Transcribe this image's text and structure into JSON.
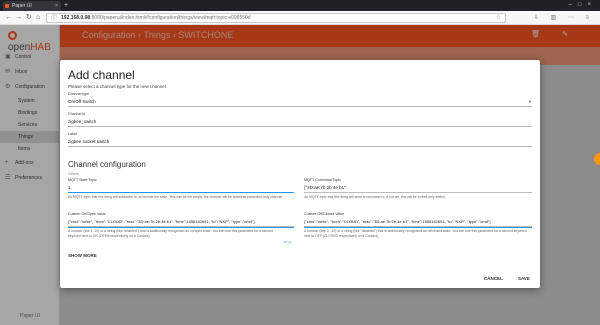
{
  "browser": {
    "tab_title": "Paper UI",
    "tab_close": "×",
    "new_tab": "+",
    "window_controls": "–□×",
    "back": "←",
    "forward": "→",
    "reload": "↻",
    "home": "⌂",
    "url_host": "192.168.0.98",
    "url_rest": ":8080/paperui/index.html#/configuration/things/view/mqtt:topic:e098550d",
    "toolbar_icons": "⇩ ▥ ⋯ ≡"
  },
  "app": {
    "logo_prefix": "open",
    "logo_brand": "HAB",
    "breadcrumb": "Configuration  ›  Things  ›  SWITCHONE",
    "footer": "Paper UI",
    "sidebar": [
      {
        "label": "Control",
        "icon": "▣"
      },
      {
        "label": "Inbox",
        "icon": "✉"
      },
      {
        "label": "Configuration",
        "icon": "⚙"
      },
      {
        "label": "System"
      },
      {
        "label": "Bindings"
      },
      {
        "label": "Services"
      },
      {
        "label": "Things"
      },
      {
        "label": "Items"
      },
      {
        "label": "Add-ons",
        "icon": "+"
      },
      {
        "label": "Preferences",
        "icon": "☰"
      }
    ],
    "header_icons": "🗑 ✎"
  },
  "dialog": {
    "title": "Add channel",
    "subtitle": "Please select a channel type for the new channel.",
    "channel_type_label": "Channel type",
    "channel_type_value": "On/Off Switch",
    "channel_id_label": "Channel id",
    "channel_id_value": "zigbee_switch",
    "label_label": "Label",
    "label_value": "zigbee socket switch",
    "section_title": "Channel configuration",
    "group_label": "Others",
    "state_topic_label": "MQTT State Topic",
    "state_topic_value": "1",
    "state_topic_help": "An MQTT topic that this thing will subscribe to, to receive the state. This can be left empty, the channel will be stateless command-only channel.",
    "command_topic_label": "MQTT Command Topic",
    "command_topic_value": "{\"3D:ae:7b:2b:4e:b1\"",
    "command_topic_help": "An MQTT topic that this thing will send a command to. If not set, this will be a read-only switch.",
    "on_value_label": "Custom On/Open Value",
    "on_value_value": "{\"cmd\":\"write\", \"from\":\"CLOUD\", \"mac\":\"3D:ae:7b:2b:4e:b1\", \"time\":1556182691, \"to\":\"NXP\", \"type\":\"cmd\"}",
    "on_value_help": "A number (like 1, 10) or a string (like \"enabled\") that is additionally recognised as on/open state. You can use this parameter for a second keyword next to ON (OPEN respectively on a Contact).",
    "off_value_label": "Custom Off/Closed Value",
    "off_value_value": "{\"cmd\":\"write\", \"from\":\"CLOUD\", \"mac\":\"3D:ae:7b:2b:4e:b1\", \"time\":1556182691, \"to\":\"NXP\", \"type\":\"cmd\"}",
    "off_value_help": "A number (like 0, -10) or a string (like \"disabled\") that is additionally recognised as off/closed state. You can use this parameter for a second keyword next to OFF (CLOSED respectively on a Contact).",
    "tiny_button": "Done",
    "show_more": "SHOW MORE",
    "cancel": "CANCEL",
    "save": "SAVE"
  }
}
